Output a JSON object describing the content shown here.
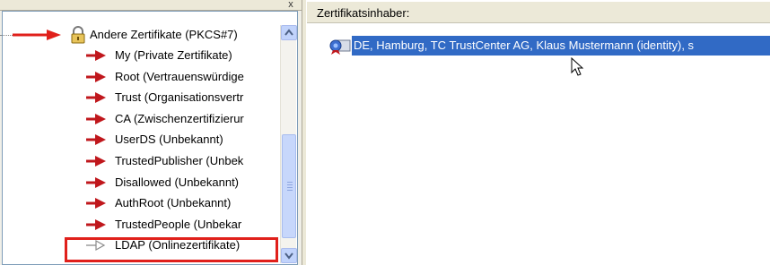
{
  "window": {
    "close_glyph": "x"
  },
  "tree": {
    "parent": {
      "label": "Andere Zertifikate (PKCS#7)",
      "icon": "lock-icon"
    },
    "children": [
      {
        "label": "My (Private Zertifikate)",
        "icon": "red-arrow-icon"
      },
      {
        "label": "Root (Vertrauenswürdige",
        "icon": "red-arrow-icon"
      },
      {
        "label": "Trust (Organisationsvertr",
        "icon": "red-arrow-icon"
      },
      {
        "label": "CA (Zwischenzertifizierur",
        "icon": "red-arrow-icon"
      },
      {
        "label": "UserDS (Unbekannt)",
        "icon": "red-arrow-icon"
      },
      {
        "label": "TrustedPublisher (Unbek",
        "icon": "red-arrow-icon"
      },
      {
        "label": "Disallowed (Unbekannt)",
        "icon": "red-arrow-icon"
      },
      {
        "label": "AuthRoot (Unbekannt)",
        "icon": "red-arrow-icon"
      },
      {
        "label": "TrustedPeople (Unbekar",
        "icon": "red-arrow-icon"
      },
      {
        "label": "LDAP (Onlinezertifikate)",
        "icon": "grey-arrow-icon",
        "highlighted": true
      }
    ]
  },
  "list": {
    "column_header": "Zertifikatsinhaber:",
    "rows": [
      {
        "label": "DE, Hamburg, TC TrustCenter AG, Klaus Mustermann (identity), s",
        "icon": "certificate-icon",
        "selected": true
      }
    ]
  },
  "colors": {
    "annotation_red": "#e0201b",
    "selection_blue": "#316ac5",
    "arrow_red": "#c0171c"
  }
}
